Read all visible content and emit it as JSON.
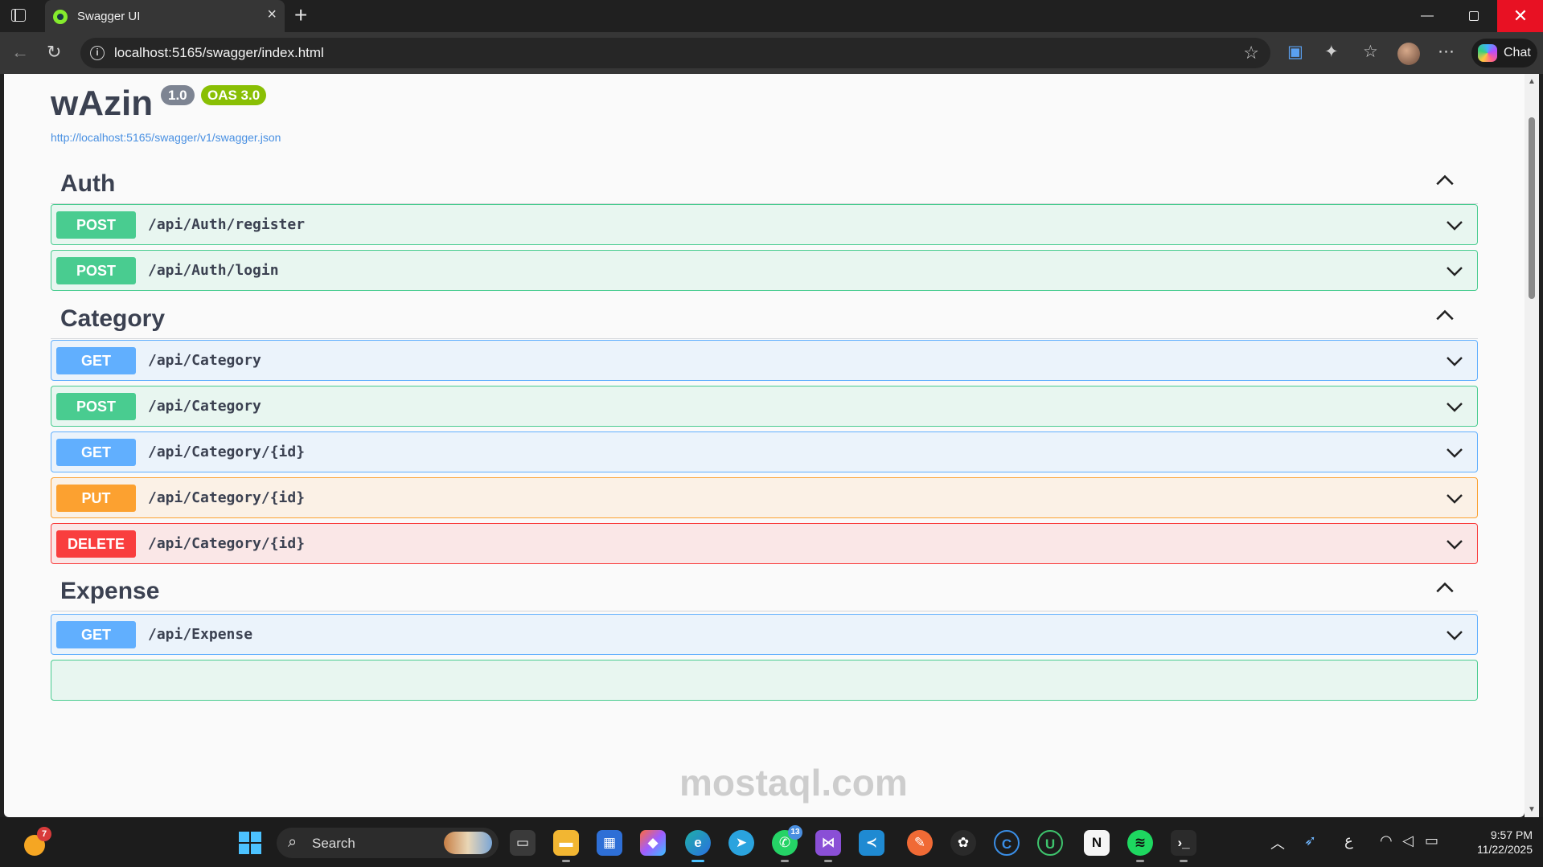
{
  "browser": {
    "tab_title": "Swagger UI",
    "url": "localhost:5165/swagger/index.html",
    "chat_label": "Chat",
    "icons": [
      "sidebar-icon",
      "swagger-favicon",
      "close-icon",
      "plus-icon",
      "back-icon",
      "refresh-icon",
      "info-icon",
      "star-icon",
      "translate-icon",
      "extensions-icon",
      "favorites-icon",
      "more-icon"
    ]
  },
  "swagger": {
    "title": "wAzin",
    "version": "1.0",
    "oas": "OAS 3.0",
    "spec_url": "http://localhost:5165/swagger/v1/swagger.json",
    "sections": [
      {
        "name": "Auth",
        "operations": [
          {
            "method": "POST",
            "path": "/api/Auth/register"
          },
          {
            "method": "POST",
            "path": "/api/Auth/login"
          }
        ]
      },
      {
        "name": "Category",
        "operations": [
          {
            "method": "GET",
            "path": "/api/Category"
          },
          {
            "method": "POST",
            "path": "/api/Category"
          },
          {
            "method": "GET",
            "path": "/api/Category/{id}"
          },
          {
            "method": "PUT",
            "path": "/api/Category/{id}"
          },
          {
            "method": "DELETE",
            "path": "/api/Category/{id}"
          }
        ]
      },
      {
        "name": "Expense",
        "operations": [
          {
            "method": "GET",
            "path": "/api/Expense"
          }
        ]
      }
    ],
    "colors": {
      "post": "#49cc90",
      "get": "#61affe",
      "put": "#fca130",
      "delete": "#f93e3e",
      "oas": "#89bf04",
      "version": "#7d8492"
    }
  },
  "watermark": "mostaql.com",
  "taskbar": {
    "weather_badge": "7",
    "search_label": "Search",
    "whatsapp_badge": "13",
    "lang": "ع",
    "time": "9:57 PM",
    "date": "11/22/2025"
  }
}
